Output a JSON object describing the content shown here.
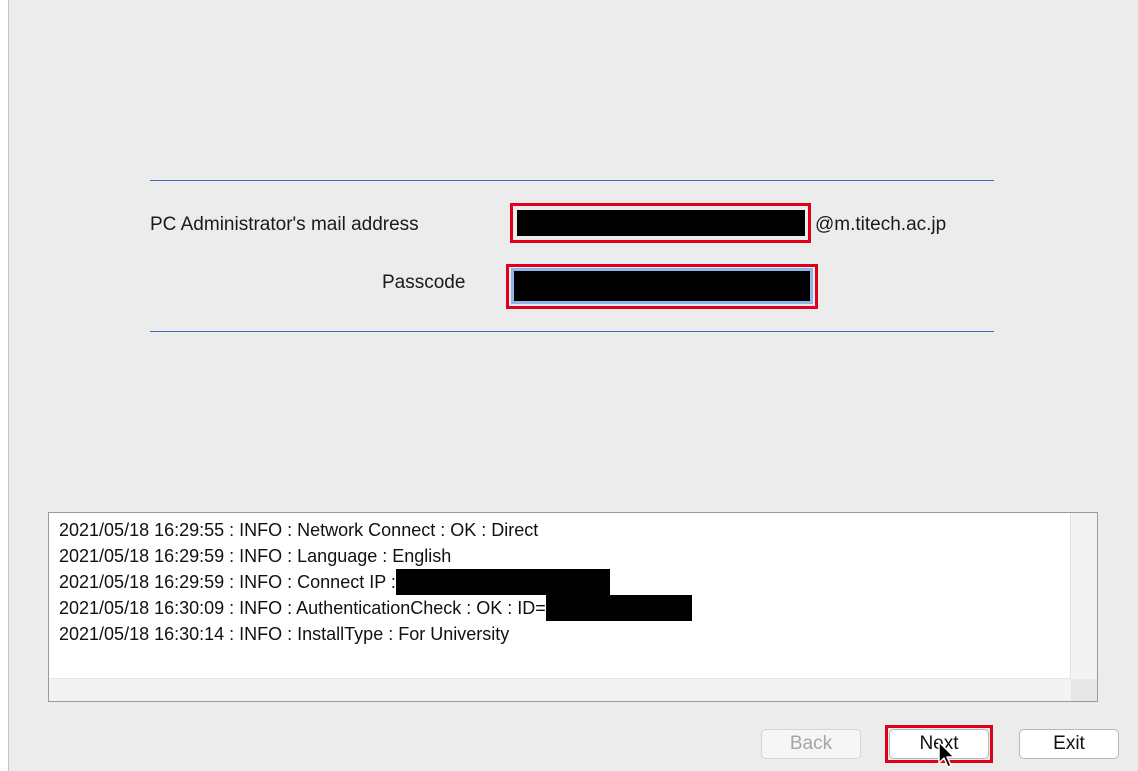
{
  "form": {
    "mail_label": "PC Administrator's mail address",
    "mail_domain": "@m.titech.ac.jp",
    "mail_value": "",
    "passcode_label": "Passcode",
    "passcode_value": ""
  },
  "log": {
    "lines": [
      {
        "text": "2021/05/18 16:29:55 : INFO  : Network Connect : OK : Direct",
        "redacted_width": 0
      },
      {
        "text": "2021/05/18 16:29:59 : INFO  : Language : English",
        "redacted_width": 0
      },
      {
        "text": "2021/05/18 16:29:59 : INFO  : Connect IP :",
        "redacted_width": 214
      },
      {
        "text": "2021/05/18 16:30:09 : INFO  : AuthenticationCheck : OK : ID=",
        "redacted_width": 146
      },
      {
        "text": "2021/05/18 16:30:14 : INFO  : InstallType : For University",
        "redacted_width": 0
      }
    ]
  },
  "buttons": {
    "back_label": "Back",
    "next_label": "Next",
    "exit_label": "Exit",
    "back_enabled": false
  },
  "colors": {
    "highlight": "#e0001b",
    "separator": "#3f6fb5",
    "focus_ring": "#8eb5e6"
  }
}
